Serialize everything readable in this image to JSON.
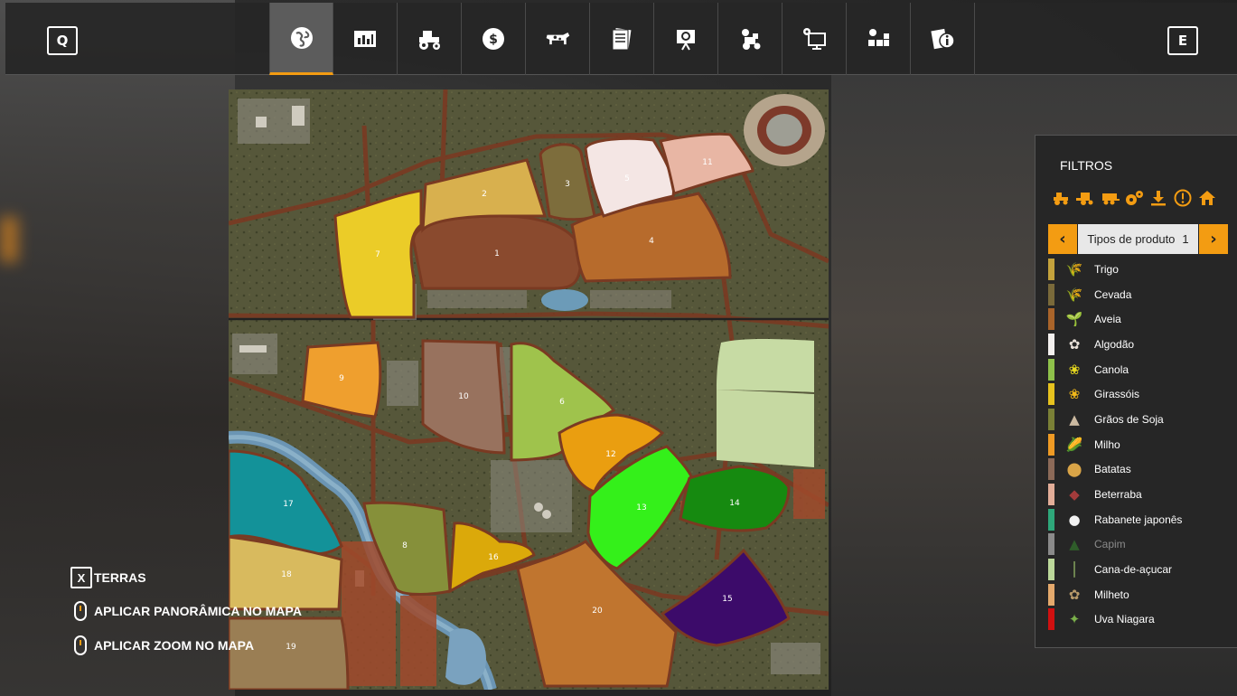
{
  "topbar": {
    "left_key": "Q",
    "right_key": "E",
    "tabs": [
      {
        "icon": "globe-icon",
        "active": true
      },
      {
        "icon": "statistics-icon",
        "active": false
      },
      {
        "icon": "tractor-icon",
        "active": false
      },
      {
        "icon": "finances-icon",
        "active": false
      },
      {
        "icon": "animals-icon",
        "active": false
      },
      {
        "icon": "contracts-icon",
        "active": false
      },
      {
        "icon": "help-icon",
        "active": false
      },
      {
        "icon": "garage-icon",
        "active": false
      },
      {
        "icon": "settings-icon",
        "active": false
      },
      {
        "icon": "production-icon",
        "active": false
      },
      {
        "icon": "info-icon",
        "active": false
      }
    ]
  },
  "map": {
    "fields": [
      {
        "id": "1",
        "color": "#8a4a2e"
      },
      {
        "id": "2",
        "color": "#d8b04e"
      },
      {
        "id": "3",
        "color": "#7d6d3c"
      },
      {
        "id": "4",
        "color": "#b76b2c"
      },
      {
        "id": "5",
        "color": "#f4e6e4"
      },
      {
        "id": "6",
        "color": "#9fc34c"
      },
      {
        "id": "7",
        "color": "#ebcc28"
      },
      {
        "id": "8",
        "color": "#86903a"
      },
      {
        "id": "9",
        "color": "#ef9f2e"
      },
      {
        "id": "10",
        "color": "#98725e"
      },
      {
        "id": "11",
        "color": "#e8b6a4"
      },
      {
        "id": "12",
        "color": "#ea9e10"
      },
      {
        "id": "13",
        "color": "#34f01a"
      },
      {
        "id": "14",
        "color": "#168a10"
      },
      {
        "id": "15",
        "color": "#3c0b6a"
      },
      {
        "id": "16",
        "color": "#dba90a"
      },
      {
        "id": "17",
        "color": "#139299"
      },
      {
        "id": "18",
        "color": "#d8ba5e"
      },
      {
        "id": "19",
        "color": "#9a7e54"
      },
      {
        "id": "20",
        "color": "#c0752f"
      }
    ]
  },
  "hints": {
    "lands": {
      "key": "X",
      "label": "TERRAS"
    },
    "pan": {
      "label": "APLICAR PANORÂMICA NO MAPA"
    },
    "zoom": {
      "label": "APLICAR ZOOM NO MAPA"
    }
  },
  "filters": {
    "title": "FILTROS",
    "selector_label": "Tipos de produto",
    "selector_page": "1",
    "accent": "#f39c12",
    "crops": [
      {
        "name": "Trigo",
        "color": "#c4a23c",
        "icon": "wheat-icon"
      },
      {
        "name": "Cevada",
        "color": "#7a6a3a",
        "icon": "barley-icon"
      },
      {
        "name": "Aveia",
        "color": "#a9642a",
        "icon": "oat-icon"
      },
      {
        "name": "Algodão",
        "color": "#f3f0ee",
        "icon": "cotton-icon"
      },
      {
        "name": "Canola",
        "color": "#8ec14a",
        "icon": "canola-icon"
      },
      {
        "name": "Girassóis",
        "color": "#e6c21e",
        "icon": "sunflower-icon"
      },
      {
        "name": "Grãos de Soja",
        "color": "#7a8036",
        "icon": "soybean-icon"
      },
      {
        "name": "Milho",
        "color": "#ee9a24",
        "icon": "maize-icon"
      },
      {
        "name": "Batatas",
        "color": "#8c6a58",
        "icon": "potato-icon"
      },
      {
        "name": "Beterraba",
        "color": "#e2ad98",
        "icon": "beetroot-icon"
      },
      {
        "name": "Rabanete japonês",
        "color": "#2ea77a",
        "icon": "radish-icon"
      },
      {
        "name": "Capim",
        "color": "#8a8a8a",
        "icon": "grass-icon",
        "dim": true
      },
      {
        "name": "Cana-de-açucar",
        "color": "#bcd89a",
        "icon": "sugarcane-icon"
      },
      {
        "name": "Milheto",
        "color": "#e4a96c",
        "icon": "millet-icon"
      },
      {
        "name": "Uva Niagara",
        "color": "#d01010",
        "icon": "grape-icon"
      }
    ]
  }
}
